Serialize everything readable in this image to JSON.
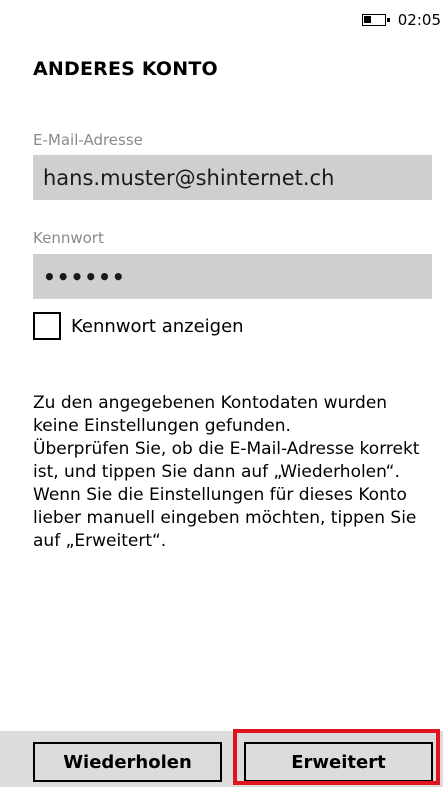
{
  "status_bar": {
    "time": "02:05",
    "battery_icon": "battery-icon",
    "battery_level": 0.35
  },
  "page": {
    "title": "ANDERES KONTO"
  },
  "email": {
    "label": "E-Mail-Adresse",
    "value": "hans.muster@shinternet.ch"
  },
  "password": {
    "label": "Kennwort",
    "value": "••••••"
  },
  "show_password": {
    "label": "Kennwort anzeigen",
    "checked": false
  },
  "message": {
    "line1": "Zu den angegebenen Kontodaten wurden keine Einstellungen gefunden.",
    "line2": "Überprüfen Sie, ob die E-Mail-Adresse korrekt ist, und tippen Sie dann auf „Wiederholen“. Wenn Sie die Einstellungen für dieses Konto lieber manuell eingeben möchten, tippen Sie auf „Erweitert“."
  },
  "buttons": {
    "retry_label": "Wiederholen",
    "advanced_label": "Erweitert"
  },
  "colors": {
    "highlight": "#e0141e",
    "field_background": "#cfcfcf",
    "label_gray": "#8a8a8a"
  }
}
